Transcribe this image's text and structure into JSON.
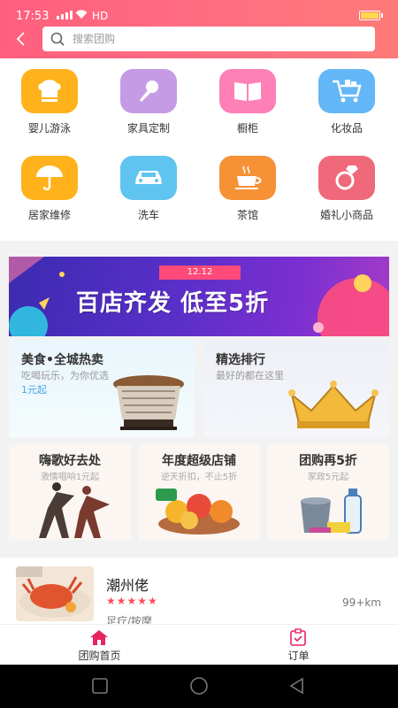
{
  "status": {
    "time": "17:53",
    "network": "HD"
  },
  "search": {
    "placeholder": "搜索团购"
  },
  "categories": [
    {
      "label": "婴儿游泳",
      "icon": "chef-hat-icon",
      "color": "#ffb21c"
    },
    {
      "label": "家具定制",
      "icon": "microphone-icon",
      "color": "#c59be6"
    },
    {
      "label": "橱柜",
      "icon": "book-icon",
      "color": "#ff7fb7"
    },
    {
      "label": "化妆品",
      "icon": "shopping-cart-icon",
      "color": "#63b7f7"
    },
    {
      "label": "居家维修",
      "icon": "umbrella-icon",
      "color": "#ffb21c"
    },
    {
      "label": "洗车",
      "icon": "car-icon",
      "color": "#5fc4ef"
    },
    {
      "label": "茶馆",
      "icon": "coffee-cup-icon",
      "color": "#f69136"
    },
    {
      "label": "婚礼小商品",
      "icon": "diamond-ring-icon",
      "color": "#f0697a"
    }
  ],
  "banner": {
    "tag": "12.12",
    "headline": "百店齐发  低至5折"
  },
  "promo_top": [
    {
      "title": "美食•全城热卖",
      "subtitle": "吃喝玩乐，为你优选",
      "price": "1元起"
    },
    {
      "title": "精选排行",
      "subtitle": "最好的都在这里"
    }
  ],
  "promo_bottom": [
    {
      "title": "嗨歌好去处",
      "subtitle": "激情唱响1元起"
    },
    {
      "title": "年度超级店铺",
      "subtitle": "逆天折扣，不止5折"
    },
    {
      "title": "团购再5折",
      "subtitle": "家政5元起"
    }
  ],
  "listing": {
    "name": "潮州佬",
    "stars": "★★★★★",
    "rating": 5,
    "distance": "99+km",
    "category": "足疗/按摩"
  },
  "tabs": [
    {
      "label": "团购首页",
      "icon": "home-icon",
      "active": true
    },
    {
      "label": "订单",
      "icon": "order-clipboard-icon",
      "active": false
    }
  ],
  "colors": {
    "accent": "#ff5f7d",
    "star": "#ff4b5c",
    "banner": "#4b2cc0"
  }
}
